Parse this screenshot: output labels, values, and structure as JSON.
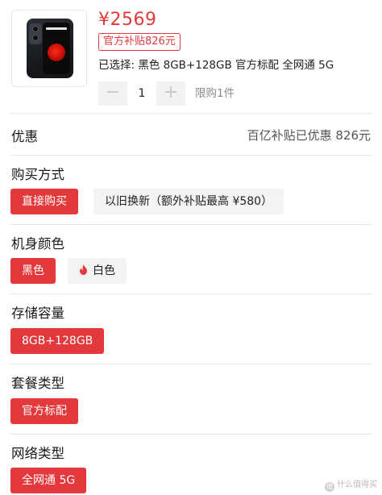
{
  "product": {
    "price": "¥2569",
    "subsidy_tag": "官方补贴826元",
    "selected": "已选择: 黑色 8GB+128GB 官方标配 全网通 5G",
    "image_icon": "phone-product-image"
  },
  "quantity": {
    "minus": "−",
    "value": "1",
    "plus": "+",
    "limit": "限购1件"
  },
  "discount": {
    "title": "优惠",
    "value": "百亿补贴已优惠 826元"
  },
  "sections": {
    "purchase": {
      "title": "购买方式",
      "options": [
        "直接购买",
        "以旧换新（额外补贴最高 ¥580）"
      ]
    },
    "color": {
      "title": "机身颜色",
      "options": [
        "黑色",
        "白色"
      ]
    },
    "storage": {
      "title": "存储容量",
      "options": [
        "8GB+128GB"
      ]
    },
    "package": {
      "title": "套餐类型",
      "options": [
        "官方标配"
      ]
    },
    "network": {
      "title": "网络类型",
      "options": [
        "全网通 5G"
      ]
    }
  },
  "colors": {
    "accent": "#e4393c",
    "chip_inactive_bg": "#f3f3f3",
    "divider": "#e5e5e5"
  },
  "watermark": {
    "text": "什么值得买",
    "icon": "zhi-logo-icon",
    "glyph": "值"
  }
}
